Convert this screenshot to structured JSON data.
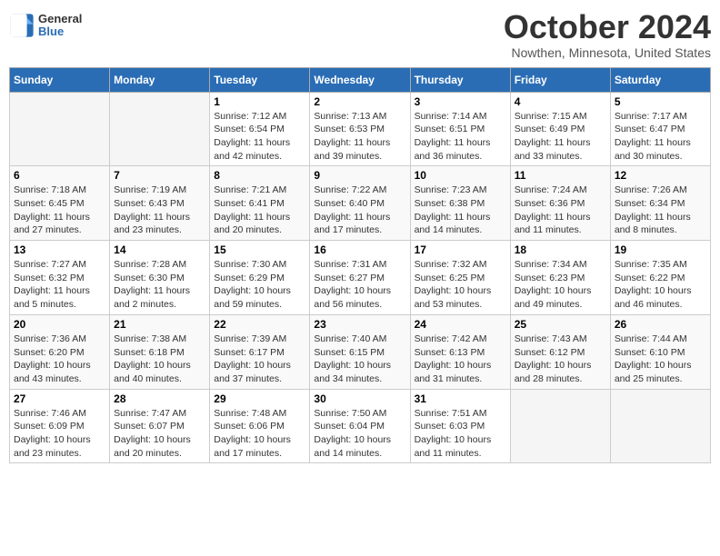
{
  "header": {
    "logo": {
      "general": "General",
      "blue": "Blue"
    },
    "title": "October 2024",
    "location": "Nowthen, Minnesota, United States"
  },
  "days_of_week": [
    "Sunday",
    "Monday",
    "Tuesday",
    "Wednesday",
    "Thursday",
    "Friday",
    "Saturday"
  ],
  "weeks": [
    [
      {
        "day": "",
        "info": ""
      },
      {
        "day": "",
        "info": ""
      },
      {
        "day": "1",
        "sunrise": "Sunrise: 7:12 AM",
        "sunset": "Sunset: 6:54 PM",
        "daylight": "Daylight: 11 hours and 42 minutes."
      },
      {
        "day": "2",
        "sunrise": "Sunrise: 7:13 AM",
        "sunset": "Sunset: 6:53 PM",
        "daylight": "Daylight: 11 hours and 39 minutes."
      },
      {
        "day": "3",
        "sunrise": "Sunrise: 7:14 AM",
        "sunset": "Sunset: 6:51 PM",
        "daylight": "Daylight: 11 hours and 36 minutes."
      },
      {
        "day": "4",
        "sunrise": "Sunrise: 7:15 AM",
        "sunset": "Sunset: 6:49 PM",
        "daylight": "Daylight: 11 hours and 33 minutes."
      },
      {
        "day": "5",
        "sunrise": "Sunrise: 7:17 AM",
        "sunset": "Sunset: 6:47 PM",
        "daylight": "Daylight: 11 hours and 30 minutes."
      }
    ],
    [
      {
        "day": "6",
        "sunrise": "Sunrise: 7:18 AM",
        "sunset": "Sunset: 6:45 PM",
        "daylight": "Daylight: 11 hours and 27 minutes."
      },
      {
        "day": "7",
        "sunrise": "Sunrise: 7:19 AM",
        "sunset": "Sunset: 6:43 PM",
        "daylight": "Daylight: 11 hours and 23 minutes."
      },
      {
        "day": "8",
        "sunrise": "Sunrise: 7:21 AM",
        "sunset": "Sunset: 6:41 PM",
        "daylight": "Daylight: 11 hours and 20 minutes."
      },
      {
        "day": "9",
        "sunrise": "Sunrise: 7:22 AM",
        "sunset": "Sunset: 6:40 PM",
        "daylight": "Daylight: 11 hours and 17 minutes."
      },
      {
        "day": "10",
        "sunrise": "Sunrise: 7:23 AM",
        "sunset": "Sunset: 6:38 PM",
        "daylight": "Daylight: 11 hours and 14 minutes."
      },
      {
        "day": "11",
        "sunrise": "Sunrise: 7:24 AM",
        "sunset": "Sunset: 6:36 PM",
        "daylight": "Daylight: 11 hours and 11 minutes."
      },
      {
        "day": "12",
        "sunrise": "Sunrise: 7:26 AM",
        "sunset": "Sunset: 6:34 PM",
        "daylight": "Daylight: 11 hours and 8 minutes."
      }
    ],
    [
      {
        "day": "13",
        "sunrise": "Sunrise: 7:27 AM",
        "sunset": "Sunset: 6:32 PM",
        "daylight": "Daylight: 11 hours and 5 minutes."
      },
      {
        "day": "14",
        "sunrise": "Sunrise: 7:28 AM",
        "sunset": "Sunset: 6:30 PM",
        "daylight": "Daylight: 11 hours and 2 minutes."
      },
      {
        "day": "15",
        "sunrise": "Sunrise: 7:30 AM",
        "sunset": "Sunset: 6:29 PM",
        "daylight": "Daylight: 10 hours and 59 minutes."
      },
      {
        "day": "16",
        "sunrise": "Sunrise: 7:31 AM",
        "sunset": "Sunset: 6:27 PM",
        "daylight": "Daylight: 10 hours and 56 minutes."
      },
      {
        "day": "17",
        "sunrise": "Sunrise: 7:32 AM",
        "sunset": "Sunset: 6:25 PM",
        "daylight": "Daylight: 10 hours and 53 minutes."
      },
      {
        "day": "18",
        "sunrise": "Sunrise: 7:34 AM",
        "sunset": "Sunset: 6:23 PM",
        "daylight": "Daylight: 10 hours and 49 minutes."
      },
      {
        "day": "19",
        "sunrise": "Sunrise: 7:35 AM",
        "sunset": "Sunset: 6:22 PM",
        "daylight": "Daylight: 10 hours and 46 minutes."
      }
    ],
    [
      {
        "day": "20",
        "sunrise": "Sunrise: 7:36 AM",
        "sunset": "Sunset: 6:20 PM",
        "daylight": "Daylight: 10 hours and 43 minutes."
      },
      {
        "day": "21",
        "sunrise": "Sunrise: 7:38 AM",
        "sunset": "Sunset: 6:18 PM",
        "daylight": "Daylight: 10 hours and 40 minutes."
      },
      {
        "day": "22",
        "sunrise": "Sunrise: 7:39 AM",
        "sunset": "Sunset: 6:17 PM",
        "daylight": "Daylight: 10 hours and 37 minutes."
      },
      {
        "day": "23",
        "sunrise": "Sunrise: 7:40 AM",
        "sunset": "Sunset: 6:15 PM",
        "daylight": "Daylight: 10 hours and 34 minutes."
      },
      {
        "day": "24",
        "sunrise": "Sunrise: 7:42 AM",
        "sunset": "Sunset: 6:13 PM",
        "daylight": "Daylight: 10 hours and 31 minutes."
      },
      {
        "day": "25",
        "sunrise": "Sunrise: 7:43 AM",
        "sunset": "Sunset: 6:12 PM",
        "daylight": "Daylight: 10 hours and 28 minutes."
      },
      {
        "day": "26",
        "sunrise": "Sunrise: 7:44 AM",
        "sunset": "Sunset: 6:10 PM",
        "daylight": "Daylight: 10 hours and 25 minutes."
      }
    ],
    [
      {
        "day": "27",
        "sunrise": "Sunrise: 7:46 AM",
        "sunset": "Sunset: 6:09 PM",
        "daylight": "Daylight: 10 hours and 23 minutes."
      },
      {
        "day": "28",
        "sunrise": "Sunrise: 7:47 AM",
        "sunset": "Sunset: 6:07 PM",
        "daylight": "Daylight: 10 hours and 20 minutes."
      },
      {
        "day": "29",
        "sunrise": "Sunrise: 7:48 AM",
        "sunset": "Sunset: 6:06 PM",
        "daylight": "Daylight: 10 hours and 17 minutes."
      },
      {
        "day": "30",
        "sunrise": "Sunrise: 7:50 AM",
        "sunset": "Sunset: 6:04 PM",
        "daylight": "Daylight: 10 hours and 14 minutes."
      },
      {
        "day": "31",
        "sunrise": "Sunrise: 7:51 AM",
        "sunset": "Sunset: 6:03 PM",
        "daylight": "Daylight: 10 hours and 11 minutes."
      },
      {
        "day": "",
        "info": ""
      },
      {
        "day": "",
        "info": ""
      }
    ]
  ]
}
